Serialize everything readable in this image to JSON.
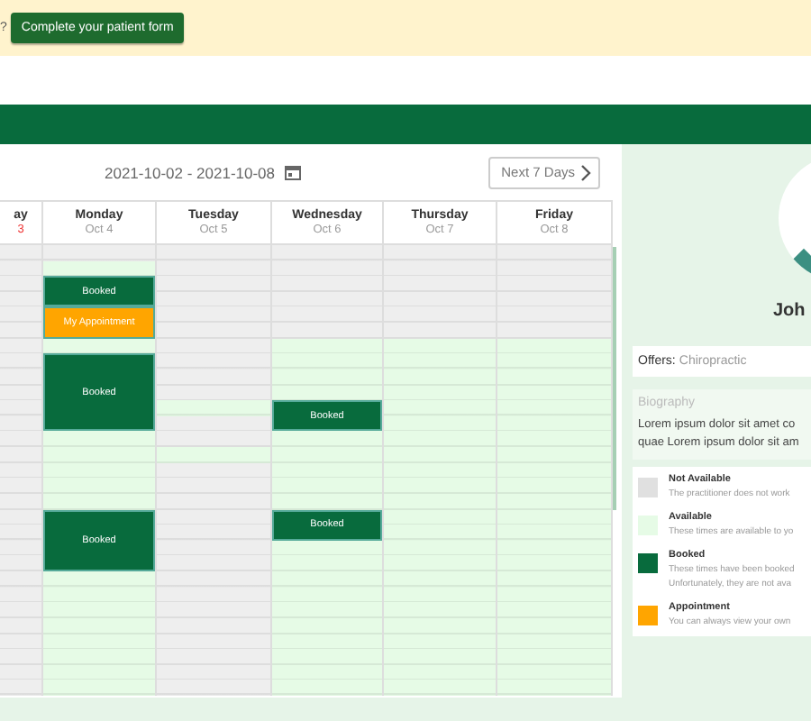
{
  "banner": {
    "prompt": "?",
    "button": "Complete your patient form"
  },
  "calendar": {
    "date_range": "2021-10-02 - 2021-10-08",
    "next_button": "Next 7 Days",
    "days": [
      {
        "name": "ay",
        "date": "3",
        "today": true,
        "slots": [
          {
            "kind": "unavailable"
          },
          {
            "kind": "unavailable"
          },
          {
            "kind": "unavailable"
          },
          {
            "kind": "unavailable"
          },
          {
            "kind": "unavailable"
          },
          {
            "kind": "unavailable"
          },
          {
            "kind": "unavailable"
          },
          {
            "kind": "unavailable"
          },
          {
            "kind": "unavailable"
          },
          {
            "kind": "unavailable"
          },
          {
            "kind": "unavailable"
          },
          {
            "kind": "unavailable"
          },
          {
            "kind": "unavailable"
          },
          {
            "kind": "unavailable"
          },
          {
            "kind": "unavailable"
          },
          {
            "kind": "unavailable"
          },
          {
            "kind": "unavailable"
          },
          {
            "kind": "unavailable"
          },
          {
            "kind": "unavailable"
          },
          {
            "kind": "unavailable"
          },
          {
            "kind": "unavailable"
          },
          {
            "kind": "unavailable"
          },
          {
            "kind": "unavailable"
          },
          {
            "kind": "unavailable"
          },
          {
            "kind": "unavailable"
          },
          {
            "kind": "unavailable"
          },
          {
            "kind": "unavailable"
          },
          {
            "kind": "unavailable"
          },
          {
            "kind": "unavailable"
          }
        ]
      },
      {
        "name": "Monday",
        "date": "Oct 4",
        "today": false,
        "slots": [
          {
            "kind": "unavailable"
          },
          {
            "kind": "available"
          },
          {
            "kind": "booked",
            "label": "Booked"
          },
          {
            "kind": "booked"
          },
          {
            "kind": "appointment",
            "label": "My Appointment"
          },
          {
            "kind": "appointment"
          },
          {
            "kind": "available"
          },
          {
            "kind": "booked",
            "label": "Booked"
          },
          {
            "kind": "booked"
          },
          {
            "kind": "booked"
          },
          {
            "kind": "booked"
          },
          {
            "kind": "booked"
          },
          {
            "kind": "available"
          },
          {
            "kind": "available"
          },
          {
            "kind": "available"
          },
          {
            "kind": "available"
          },
          {
            "kind": "available"
          },
          {
            "kind": "booked",
            "label": "Booked"
          },
          {
            "kind": "booked"
          },
          {
            "kind": "booked"
          },
          {
            "kind": "booked"
          },
          {
            "kind": "available"
          },
          {
            "kind": "available"
          },
          {
            "kind": "available"
          },
          {
            "kind": "available"
          },
          {
            "kind": "available"
          },
          {
            "kind": "available"
          },
          {
            "kind": "available"
          },
          {
            "kind": "available"
          }
        ]
      },
      {
        "name": "Tuesday",
        "date": "Oct 5",
        "today": false,
        "slots": [
          {
            "kind": "unavailable"
          },
          {
            "kind": "unavailable"
          },
          {
            "kind": "unavailable"
          },
          {
            "kind": "unavailable"
          },
          {
            "kind": "unavailable"
          },
          {
            "kind": "unavailable"
          },
          {
            "kind": "unavailable"
          },
          {
            "kind": "unavailable"
          },
          {
            "kind": "unavailable"
          },
          {
            "kind": "unavailable"
          },
          {
            "kind": "available"
          },
          {
            "kind": "unavailable"
          },
          {
            "kind": "unavailable"
          },
          {
            "kind": "available"
          },
          {
            "kind": "unavailable"
          },
          {
            "kind": "unavailable"
          },
          {
            "kind": "unavailable"
          },
          {
            "kind": "unavailable"
          },
          {
            "kind": "unavailable"
          },
          {
            "kind": "unavailable"
          },
          {
            "kind": "unavailable"
          },
          {
            "kind": "unavailable"
          },
          {
            "kind": "unavailable"
          },
          {
            "kind": "unavailable"
          },
          {
            "kind": "unavailable"
          },
          {
            "kind": "unavailable"
          },
          {
            "kind": "unavailable"
          },
          {
            "kind": "unavailable"
          },
          {
            "kind": "unavailable"
          }
        ]
      },
      {
        "name": "Wednesday",
        "date": "Oct 6",
        "today": false,
        "slots": [
          {
            "kind": "unavailable"
          },
          {
            "kind": "unavailable"
          },
          {
            "kind": "unavailable"
          },
          {
            "kind": "unavailable"
          },
          {
            "kind": "unavailable"
          },
          {
            "kind": "unavailable"
          },
          {
            "kind": "available"
          },
          {
            "kind": "available"
          },
          {
            "kind": "available"
          },
          {
            "kind": "available"
          },
          {
            "kind": "booked",
            "label": "Booked"
          },
          {
            "kind": "booked"
          },
          {
            "kind": "available"
          },
          {
            "kind": "available"
          },
          {
            "kind": "available"
          },
          {
            "kind": "available"
          },
          {
            "kind": "available"
          },
          {
            "kind": "booked",
            "label": "Booked"
          },
          {
            "kind": "booked"
          },
          {
            "kind": "available"
          },
          {
            "kind": "available"
          },
          {
            "kind": "available"
          },
          {
            "kind": "available"
          },
          {
            "kind": "available"
          },
          {
            "kind": "available"
          },
          {
            "kind": "available"
          },
          {
            "kind": "available"
          },
          {
            "kind": "available"
          },
          {
            "kind": "available"
          }
        ]
      },
      {
        "name": "Thursday",
        "date": "Oct 7",
        "today": false,
        "slots": [
          {
            "kind": "unavailable"
          },
          {
            "kind": "unavailable"
          },
          {
            "kind": "unavailable"
          },
          {
            "kind": "unavailable"
          },
          {
            "kind": "unavailable"
          },
          {
            "kind": "unavailable"
          },
          {
            "kind": "available"
          },
          {
            "kind": "available"
          },
          {
            "kind": "available"
          },
          {
            "kind": "available"
          },
          {
            "kind": "available"
          },
          {
            "kind": "available"
          },
          {
            "kind": "available"
          },
          {
            "kind": "available"
          },
          {
            "kind": "available"
          },
          {
            "kind": "available"
          },
          {
            "kind": "available"
          },
          {
            "kind": "available"
          },
          {
            "kind": "available"
          },
          {
            "kind": "available"
          },
          {
            "kind": "available"
          },
          {
            "kind": "available"
          },
          {
            "kind": "available"
          },
          {
            "kind": "available"
          },
          {
            "kind": "available"
          },
          {
            "kind": "available"
          },
          {
            "kind": "available"
          },
          {
            "kind": "available"
          },
          {
            "kind": "available"
          }
        ]
      },
      {
        "name": "Friday",
        "date": "Oct 8",
        "today": false,
        "slots": [
          {
            "kind": "unavailable"
          },
          {
            "kind": "unavailable"
          },
          {
            "kind": "unavailable"
          },
          {
            "kind": "unavailable"
          },
          {
            "kind": "unavailable"
          },
          {
            "kind": "unavailable"
          },
          {
            "kind": "available"
          },
          {
            "kind": "available"
          },
          {
            "kind": "available"
          },
          {
            "kind": "available"
          },
          {
            "kind": "available"
          },
          {
            "kind": "available"
          },
          {
            "kind": "available"
          },
          {
            "kind": "available"
          },
          {
            "kind": "available"
          },
          {
            "kind": "available"
          },
          {
            "kind": "available"
          },
          {
            "kind": "available"
          },
          {
            "kind": "available"
          },
          {
            "kind": "available"
          },
          {
            "kind": "available"
          },
          {
            "kind": "available"
          },
          {
            "kind": "available"
          },
          {
            "kind": "available"
          },
          {
            "kind": "available"
          },
          {
            "kind": "available"
          },
          {
            "kind": "available"
          },
          {
            "kind": "available"
          },
          {
            "kind": "available"
          }
        ]
      }
    ]
  },
  "practitioner": {
    "name": "Joh",
    "offers_label": "Offers:",
    "offers": "Chiropractic",
    "biography_title": "Biography",
    "biography_lines": [
      "Lorem ipsum dolor sit amet co",
      "quae Lorem ipsum dolor sit am"
    ]
  },
  "legend": [
    {
      "color": "#e0e0e0",
      "title": "Not Available",
      "lines": [
        "The practitioner does not work"
      ]
    },
    {
      "color": "#e6fbe6",
      "title": "Available",
      "lines": [
        "These times are available to yo"
      ]
    },
    {
      "color": "#086b3d",
      "title": "Booked",
      "lines": [
        "These times have been booked",
        "Unfortunately, they are not ava"
      ]
    },
    {
      "color": "#ffa500",
      "title": "Appointment",
      "lines": [
        "You can always view your own"
      ]
    }
  ]
}
